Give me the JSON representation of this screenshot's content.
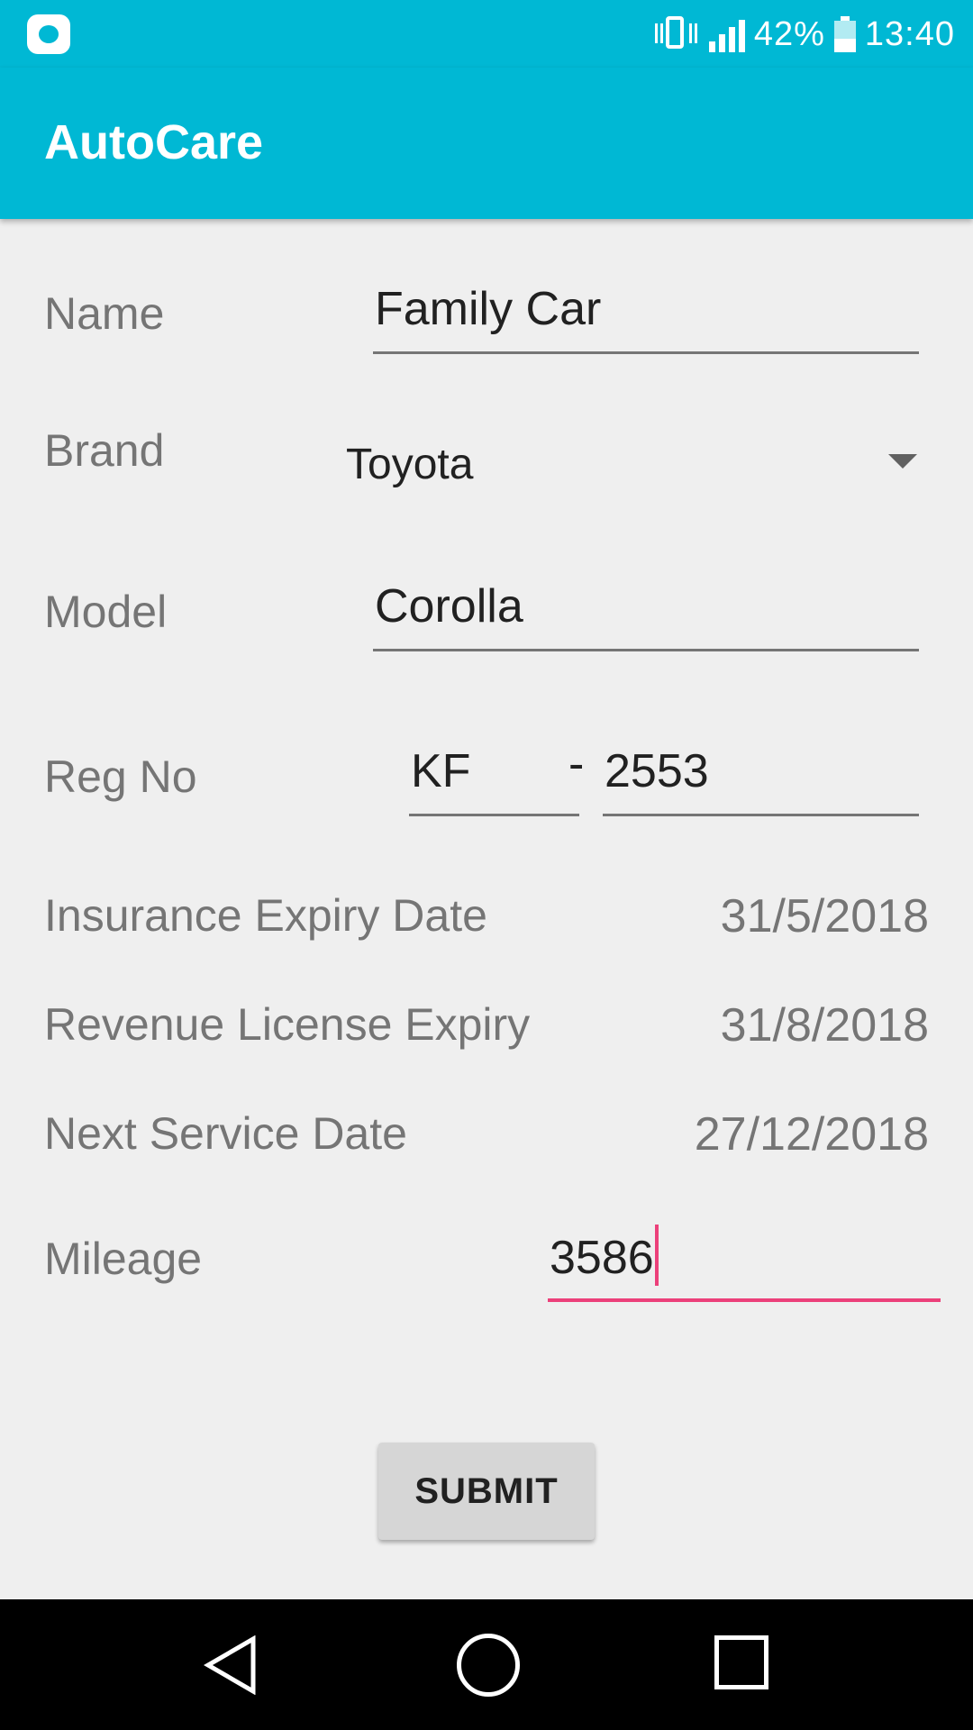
{
  "status_bar": {
    "battery_percent_text": "42%",
    "battery_level": 0.42,
    "time": "13:40",
    "icons": [
      "app-notification-icon",
      "vibrate-icon",
      "signal-icon",
      "battery-icon"
    ]
  },
  "app_bar": {
    "title": "AutoCare"
  },
  "form": {
    "name": {
      "label": "Name",
      "value": "Family Car"
    },
    "brand": {
      "label": "Brand",
      "value": "Toyota"
    },
    "model": {
      "label": "Model",
      "value": "Corolla"
    },
    "reg_no": {
      "label": "Reg No",
      "prefix": "KF",
      "separator": "-",
      "number": "2553"
    },
    "insurance_expiry": {
      "label": "Insurance Expiry Date",
      "value": "31/5/2018"
    },
    "revenue_license_expiry": {
      "label": "Revenue License Expiry",
      "value": "31/8/2018"
    },
    "next_service_date": {
      "label": "Next Service Date",
      "value": "27/12/2018"
    },
    "mileage": {
      "label": "Mileage",
      "value": "3586"
    },
    "submit_label": "SUBMIT"
  },
  "colors": {
    "primary": "#00b8d4",
    "accent": "#ec407a",
    "background": "#efefef"
  }
}
